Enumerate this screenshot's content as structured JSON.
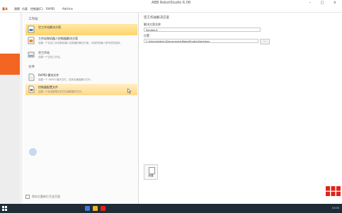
{
  "window": {
    "title": "ABB RobotStudio 6.08",
    "controls": "– □ ×"
  },
  "menu": [
    {
      "label": "基本"
    },
    {
      "label": "建模"
    },
    {
      "label": "仿真"
    },
    {
      "label": "控制器(C)"
    },
    {
      "label": "RAPID"
    },
    {
      "label": "Add-Ins"
    }
  ],
  "tasks": {
    "section1": "工作站",
    "section2": "文件",
    "items": [
      {
        "title": "空工作站解决方案",
        "desc": ""
      },
      {
        "title": "工作站和机器人控制器解决方案",
        "desc": "创建一个包含工作站和机器人控制器的解决方案。可用的机器人型号供您选择。"
      },
      {
        "title": "空工作站",
        "desc": "创建一个空的工作站。"
      },
      {
        "title": "RAPID 模块文件",
        "desc": "创建一个 RAPID 模块文件，将其在编辑器中打开。"
      },
      {
        "title": "控制器配置文件",
        "desc": "创建一个标准配置文件并在编辑器中打开。"
      }
    ],
    "footer_check": "保存后重新打开此页面"
  },
  "form": {
    "heading": "空工作站解决方案",
    "name_label": "解决方案名称",
    "name_value": "Solution1",
    "location_label": "位置",
    "location_value": "C:\\Users\\Admin\\Documents\\RobotStudio\\Solutions",
    "browse_label": "...",
    "create_label": "创建"
  },
  "tray": {
    "time": "10:00"
  },
  "colors": {
    "accent": "#f26522",
    "selected": "#ffd36b",
    "brand_red": "#e2231a"
  }
}
